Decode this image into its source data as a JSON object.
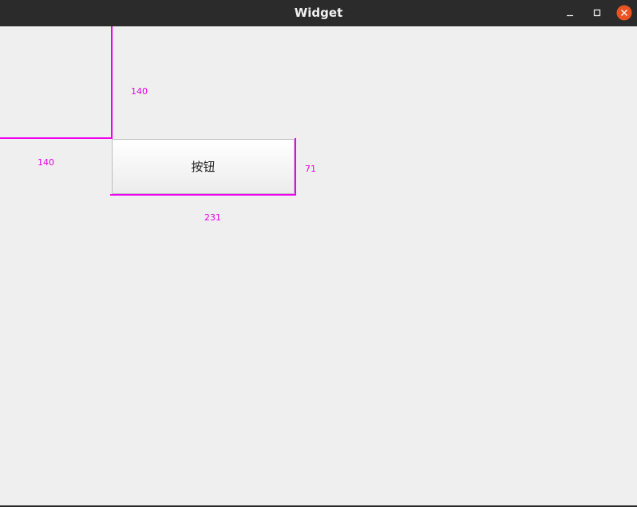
{
  "window": {
    "title": "Widget",
    "controls": {
      "minimize_icon": "minimize-icon",
      "maximize_icon": "maximize-icon",
      "close_icon": "close-icon"
    }
  },
  "content": {
    "button_label": "按钮"
  },
  "measurements": {
    "top_margin": "140",
    "left_margin": "140",
    "button_height": "71",
    "button_width": "231"
  },
  "colors": {
    "titlebar": "#2b2b2b",
    "background": "#efefef",
    "guide_lines": "#f000f0",
    "close_button": "#e95420"
  }
}
